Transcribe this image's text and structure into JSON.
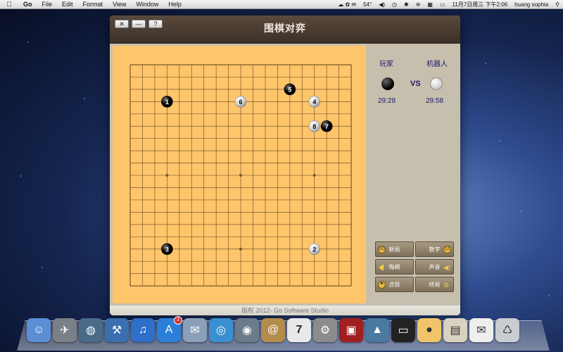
{
  "menubar": {
    "apple": "",
    "app_name": "Go",
    "items": [
      "File",
      "Edit",
      "Format",
      "View",
      "Window",
      "Help"
    ],
    "weather": "54°",
    "datetime": "11月7日周三 下午2:06",
    "user": "huang sophia"
  },
  "window": {
    "title": "围棋对弈",
    "close_label": "✕",
    "minimize_label": "—",
    "help_label": "?",
    "footer": "版权 2012- Go Software Studio"
  },
  "players": {
    "player_label": "玩家",
    "computer_label": "机器人",
    "vs_label": "VS",
    "player_time": "29:28",
    "computer_time": "29:58"
  },
  "controls": {
    "new_game": "新局",
    "numbers": "数字",
    "undo": "悔棋",
    "sound": "声音",
    "count": "点目",
    "end_game": "终局"
  },
  "board": {
    "size": 19,
    "hoshi": [
      [
        3,
        3
      ],
      [
        3,
        9
      ],
      [
        3,
        15
      ],
      [
        9,
        3
      ],
      [
        9,
        9
      ],
      [
        9,
        15
      ],
      [
        15,
        3
      ],
      [
        15,
        9
      ],
      [
        15,
        15
      ]
    ],
    "stones": [
      {
        "col": 3,
        "row": 3,
        "color": "black",
        "number": "1"
      },
      {
        "col": 15,
        "row": 15,
        "color": "white",
        "number": "2"
      },
      {
        "col": 3,
        "row": 15,
        "color": "black",
        "number": "3"
      },
      {
        "col": 15,
        "row": 3,
        "color": "white",
        "number": "4"
      },
      {
        "col": 13,
        "row": 2,
        "color": "black",
        "number": "5"
      },
      {
        "col": 9,
        "row": 3,
        "color": "white",
        "number": "6"
      },
      {
        "col": 16,
        "row": 5,
        "color": "black",
        "number": "7"
      },
      {
        "col": 15,
        "row": 5,
        "color": "white",
        "number": "8"
      }
    ]
  },
  "dock": {
    "icons": [
      "finder-icon",
      "launchpad-icon",
      "dashboard-icon",
      "xcode-icon",
      "itunes-icon",
      "app-store-icon",
      "mail-bird-icon",
      "safari-icon",
      "facetime-icon",
      "address-book-icon",
      "calendar-icon",
      "system-preferences-icon",
      "photo-booth-icon",
      "preview-icon",
      "terminal-icon",
      "go-game-icon",
      "downloads-stack-icon",
      "documents-stack-icon",
      "trash-icon"
    ],
    "calendar_day": "7",
    "app_store_badge": "3"
  }
}
